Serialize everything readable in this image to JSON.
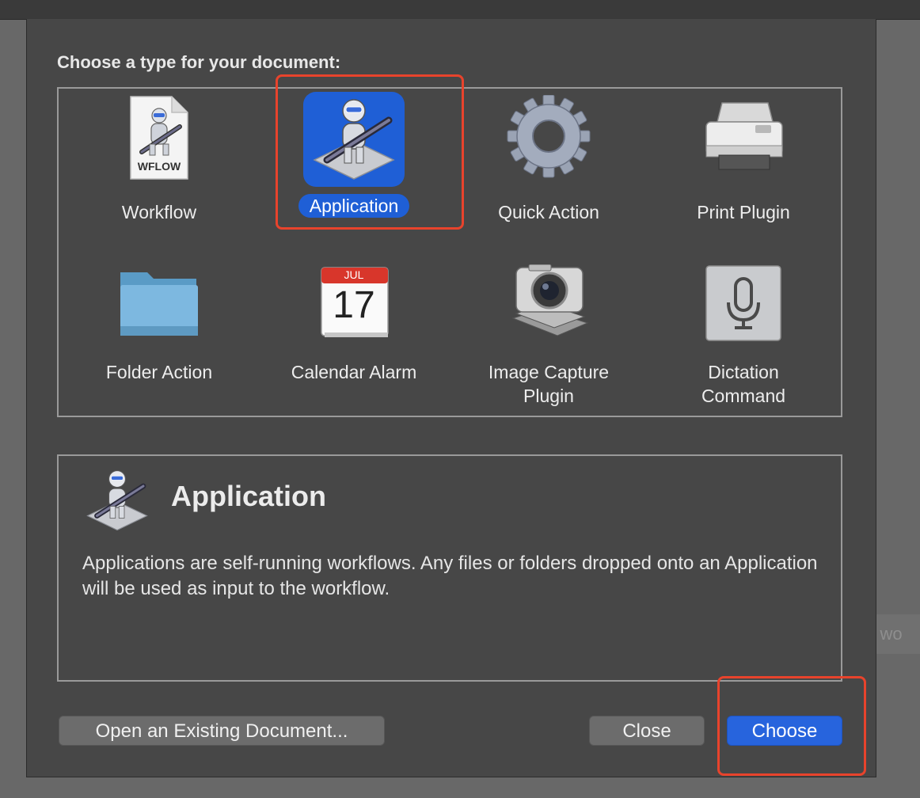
{
  "dialog": {
    "prompt": "Choose a type for your document:",
    "types": [
      {
        "id": "workflow",
        "label": "Workflow",
        "icon": "wflow-document-icon",
        "icon_text": "WFLOW",
        "selected": false
      },
      {
        "id": "application",
        "label": "Application",
        "icon": "automator-robot-icon",
        "selected": true
      },
      {
        "id": "quick-action",
        "label": "Quick Action",
        "icon": "gear-icon",
        "selected": false
      },
      {
        "id": "print-plugin",
        "label": "Print Plugin",
        "icon": "printer-icon",
        "selected": false
      },
      {
        "id": "folder-action",
        "label": "Folder Action",
        "icon": "folder-icon",
        "selected": false
      },
      {
        "id": "calendar-alarm",
        "label": "Calendar Alarm",
        "icon": "calendar-icon",
        "icon_month": "JUL",
        "icon_day": "17",
        "selected": false
      },
      {
        "id": "image-capture-plugin",
        "label": "Image Capture Plugin",
        "label_line1": "Image Capture",
        "label_line2": "Plugin",
        "icon": "camera-icon",
        "selected": false
      },
      {
        "id": "dictation-command",
        "label": "Dictation Command",
        "label_line1": "Dictation",
        "label_line2": "Command",
        "icon": "microphone-icon",
        "selected": false
      }
    ],
    "description": {
      "title": "Application",
      "text": "Applications are self-running workflows. Any files or folders dropped onto an Application will be used as input to the workflow."
    },
    "buttons": {
      "open_existing": "Open an Existing Document...",
      "close": "Close",
      "choose": "Choose"
    }
  },
  "background": {
    "fragment_text": "r wo"
  },
  "colors": {
    "accent": "#1f5fd6",
    "highlight": "#e8432c",
    "sheet_bg": "#474747"
  }
}
